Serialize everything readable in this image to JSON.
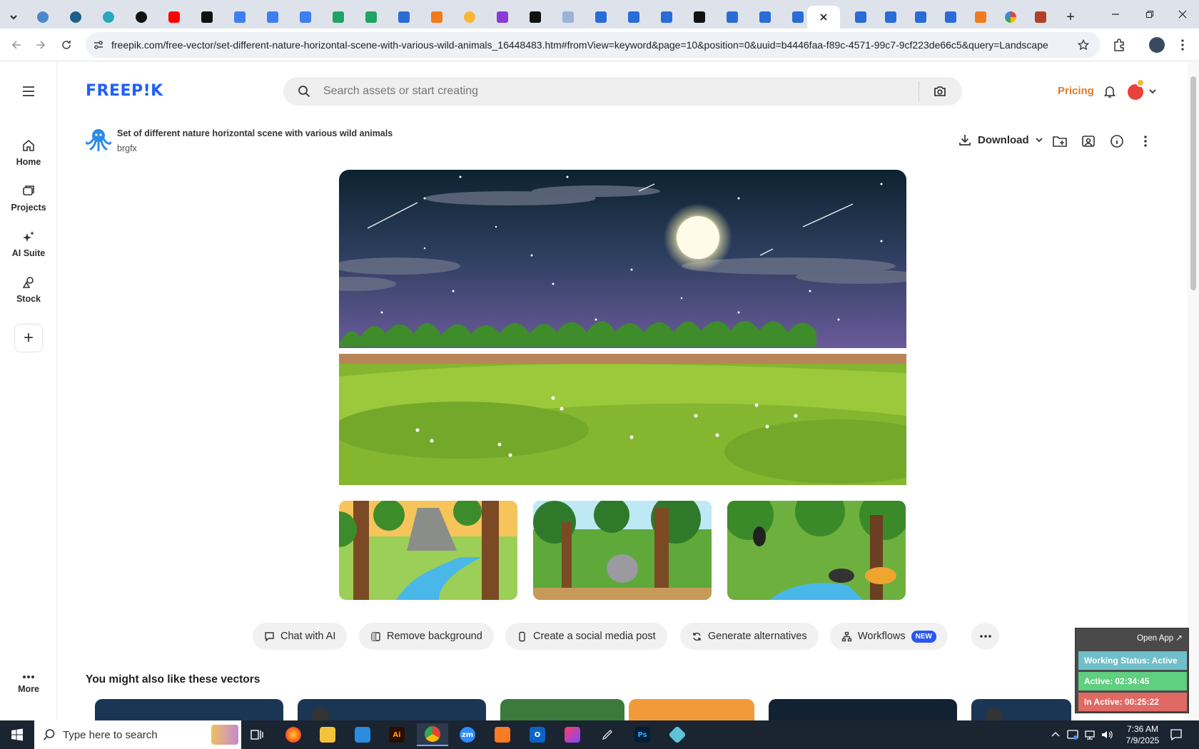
{
  "browser": {
    "url": "freepik.com/free-vector/set-different-nature-horizontal-scene-with-various-wild-animals_16448483.htm#fromView=keyword&page=10&position=0&uuid=b4446faa-f89c-4571-99c7-9cf223de66c5&query=Landscape",
    "new_tab": "+"
  },
  "sidebar": {
    "items": [
      {
        "label": "Home"
      },
      {
        "label": "Projects"
      },
      {
        "label": "AI Suite"
      },
      {
        "label": "Stock"
      }
    ],
    "add": "+",
    "more": "More"
  },
  "header": {
    "logo": "FREEP!K",
    "search_placeholder": "Search assets or start creating",
    "pricing": "Pricing"
  },
  "resource": {
    "title": "Set of different nature horizontal scene with various wild animals",
    "author": "brgfx",
    "download_label": "Download"
  },
  "actions": [
    {
      "label": "Chat with AI"
    },
    {
      "label": "Remove background"
    },
    {
      "label": "Create a social media post"
    },
    {
      "label": "Generate alternatives"
    },
    {
      "label": "Workflows",
      "badge": "NEW"
    }
  ],
  "related": {
    "heading": "You might also like these vectors"
  },
  "widget": {
    "open_app": "Open App ↗",
    "working_status": "Working Status: Active",
    "active": "Active: 02:34:45",
    "inactive": "In Active: 00:25:22"
  },
  "taskbar": {
    "search_placeholder": "Type here to search",
    "time": "7:36 AM",
    "date": "7/9/2025"
  },
  "colors": {
    "brand_blue": "#1f5fff",
    "pricing_orange": "#e0792b",
    "status_teal": "#6fbfc9",
    "status_green": "#5fcf80",
    "status_red": "#e06a63"
  }
}
